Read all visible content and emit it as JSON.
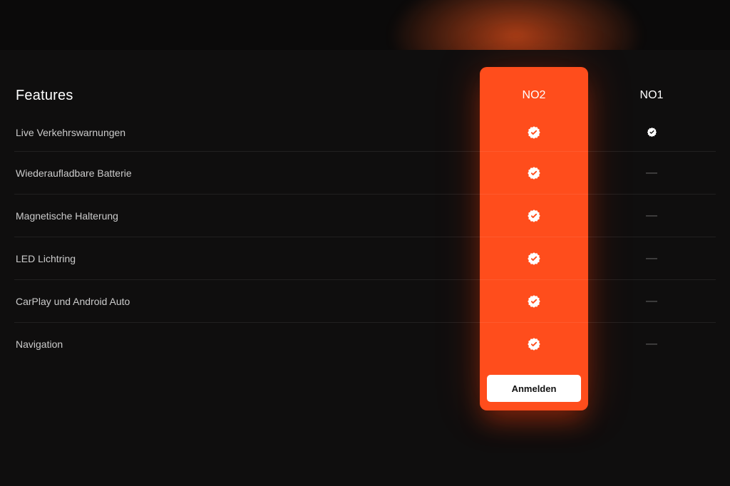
{
  "glow": true,
  "header": {
    "features_label": "Features",
    "col_no2_label": "NO2",
    "col_no1_label": "NO1"
  },
  "rows": [
    {
      "name": "Live Verkehrswarnungen",
      "no2": true,
      "no1": true
    },
    {
      "name": "Wiederaufladbare Batterie",
      "no2": true,
      "no1": false
    },
    {
      "name": "Magnetische Halterung",
      "no2": true,
      "no1": false
    },
    {
      "name": "LED Lichtring",
      "no2": true,
      "no1": false
    },
    {
      "name": "CarPlay und Android Auto",
      "no2": true,
      "no1": false
    },
    {
      "name": "Navigation",
      "no2": true,
      "no1": false
    }
  ],
  "cta_label": "Anmelden",
  "colors": {
    "accent": "#ff4d1c",
    "bg": "#0b0a0a"
  }
}
